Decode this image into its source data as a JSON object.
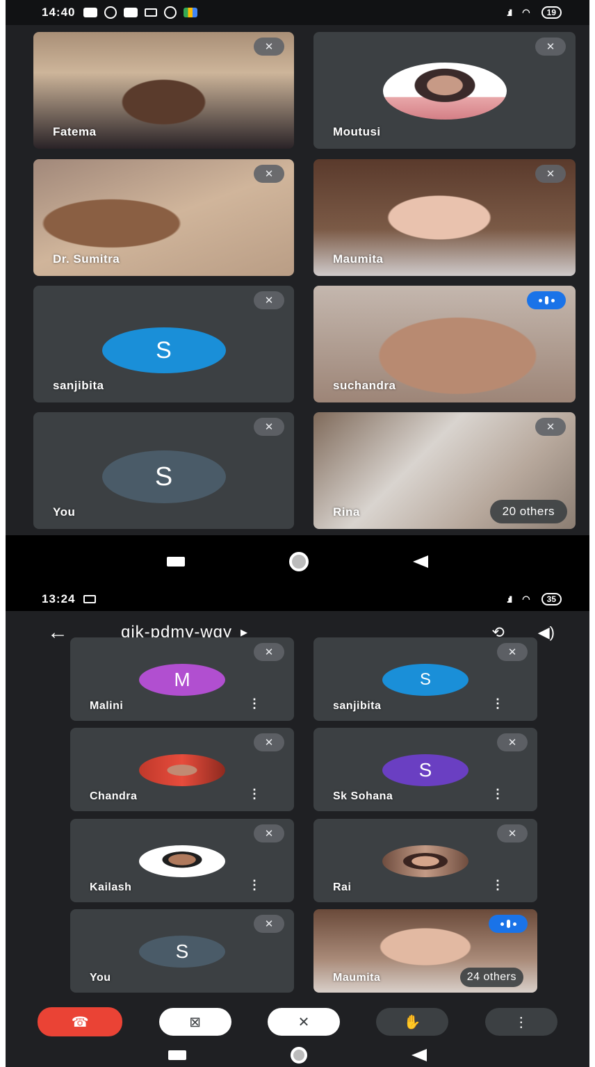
{
  "screen1": {
    "status": {
      "time": "14:40",
      "battery": "19"
    },
    "tiles": [
      {
        "name": "Fatema"
      },
      {
        "name": "Moutusi"
      },
      {
        "name": "Dr. Sumitra"
      },
      {
        "name": "Maumita"
      },
      {
        "name": "sanjibita",
        "initial": "S"
      },
      {
        "name": "suchandra"
      },
      {
        "name": "You",
        "initial": "S"
      },
      {
        "name": "Rina",
        "others": "20 others"
      }
    ]
  },
  "screen2": {
    "status": {
      "time": "13:24",
      "battery": "35"
    },
    "meeting_code": "qjk-pdmy-wgy",
    "tiles": [
      {
        "name": "Malini",
        "initial": "M"
      },
      {
        "name": "sanjibita",
        "initial": "S"
      },
      {
        "name": "Chandra"
      },
      {
        "name": "Sk Sohana",
        "initial": "S"
      },
      {
        "name": "Kailash"
      },
      {
        "name": "Rai"
      },
      {
        "name": "You",
        "initial": "S"
      },
      {
        "name": "Maumita",
        "others": "24 others"
      }
    ]
  },
  "icons": {
    "mic_off": "mic-off-icon",
    "speaking": "speaking-indicator-icon",
    "more": "more-vert-icon",
    "back": "arrow-back-icon",
    "camera_flip": "camera-flip-icon",
    "speaker": "speaker-icon",
    "end_call": "call-end-icon",
    "video_off": "videocam-off-icon",
    "hand": "raise-hand-icon"
  },
  "colors": {
    "background": "#202124",
    "tile": "#3c4043",
    "end_call": "#ea4335",
    "speaking": "#1a73e8",
    "avatar_blue": "#1a8fd8",
    "avatar_slate": "#4a5b68",
    "avatar_purple": "#b14fd0",
    "avatar_violet": "#6a3fc2"
  }
}
